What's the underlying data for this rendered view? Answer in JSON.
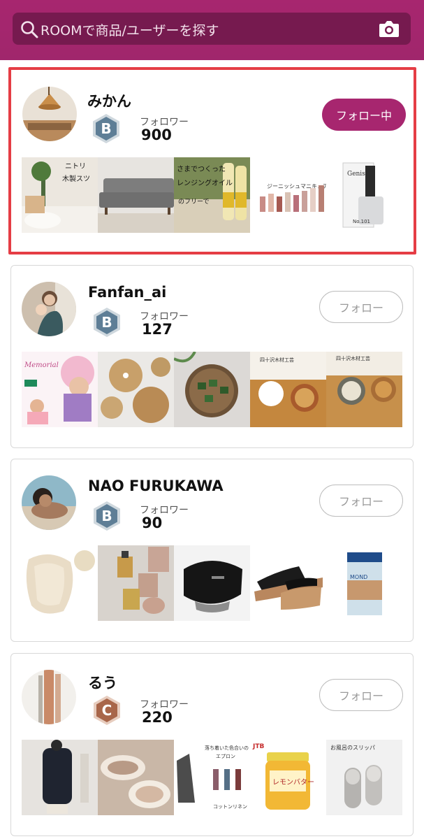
{
  "search": {
    "placeholder": "ROOMで商品/ユーザーを探す",
    "search_icon": "search-icon",
    "camera_icon": "camera-icon"
  },
  "colors": {
    "brand": "#a7266f",
    "search_bg": "#761a4f",
    "highlight_border": "#e53d45",
    "rank_b": "#5e7e96",
    "rank_c": "#a8664a"
  },
  "users": [
    {
      "name": "みかん",
      "rank": "B",
      "follower_label": "フォロワー",
      "follower_count": "900",
      "button_label": "フォロー中",
      "following": true,
      "highlighted": true
    },
    {
      "name": "Fanfan_ai",
      "rank": "B",
      "follower_label": "フォロワー",
      "follower_count": "127",
      "button_label": "フォロー",
      "following": false,
      "highlighted": false
    },
    {
      "name": "NAO FURUKAWA",
      "rank": "B",
      "follower_label": "フォロワー",
      "follower_count": "90",
      "button_label": "フォロー",
      "following": false,
      "highlighted": false
    },
    {
      "name": "るう",
      "rank": "C",
      "follower_label": "フォロワー",
      "follower_count": "220",
      "button_label": "フォロー",
      "following": false,
      "highlighted": false
    }
  ]
}
